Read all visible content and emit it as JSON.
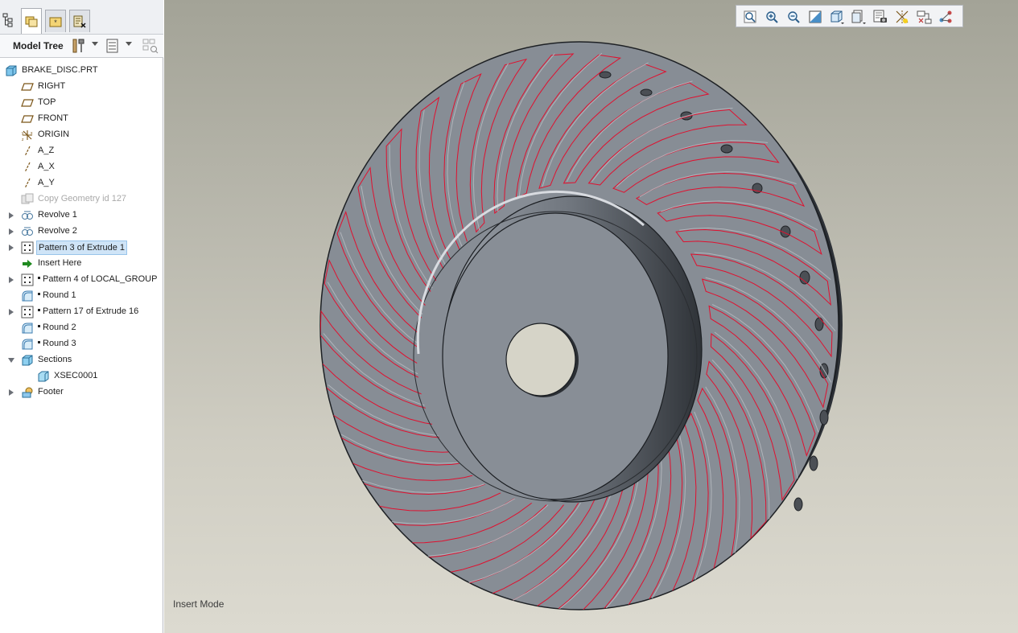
{
  "panel": {
    "title": "Model Tree",
    "tabs": [
      "model-tree-tab",
      "folder-browser-tab",
      "favorites-tab",
      "layer-tab"
    ]
  },
  "tree": {
    "items": [
      {
        "label": "BRAKE_DISC.PRT",
        "icon": "part-icon"
      },
      {
        "label": "RIGHT",
        "icon": "datum-plane-icon"
      },
      {
        "label": "TOP",
        "icon": "datum-plane-icon"
      },
      {
        "label": "FRONT",
        "icon": "datum-plane-icon"
      },
      {
        "label": "ORIGIN",
        "icon": "coordinate-system-icon"
      },
      {
        "label": "A_Z",
        "icon": "datum-axis-icon"
      },
      {
        "label": "A_X",
        "icon": "datum-axis-icon"
      },
      {
        "label": "A_Y",
        "icon": "datum-axis-icon"
      },
      {
        "label": "Copy Geometry id 127",
        "icon": "copy-geometry-icon",
        "suppressed": true
      },
      {
        "label": "Revolve 1",
        "icon": "revolve-icon",
        "expandable": true
      },
      {
        "label": "Revolve 2",
        "icon": "revolve-icon",
        "expandable": true
      },
      {
        "label": "Pattern 3 of Extrude 1",
        "icon": "pattern-icon",
        "expandable": true,
        "selected": true
      },
      {
        "label": "Insert Here",
        "icon": "insert-arrow-icon"
      },
      {
        "label": "Pattern 4 of LOCAL_GROUP",
        "icon": "pattern-icon",
        "expandable": true,
        "after_insert": true
      },
      {
        "label": "Round 1",
        "icon": "round-icon",
        "after_insert": true
      },
      {
        "label": "Pattern 17 of Extrude 16",
        "icon": "pattern-icon",
        "expandable": true,
        "after_insert": true
      },
      {
        "label": "Round 2",
        "icon": "round-icon",
        "after_insert": true
      },
      {
        "label": "Round 3",
        "icon": "round-icon",
        "after_insert": true
      },
      {
        "label": "Sections",
        "icon": "sections-icon",
        "expanded": true
      },
      {
        "label": "XSEC0001",
        "icon": "xsection-icon",
        "child": true
      },
      {
        "label": "Footer",
        "icon": "footer-icon",
        "expandable": true
      }
    ]
  },
  "view_toolbar": {
    "buttons": [
      "refit-icon",
      "zoom-in-icon",
      "zoom-out-icon",
      "repaint-icon",
      "display-style-icon",
      "saved-views-icon",
      "view-manager-icon",
      "datum-display-icon",
      "spin-center-icon",
      "annotation-display-icon"
    ]
  },
  "status": {
    "mode": "Insert Mode"
  },
  "colors": {
    "accent": "#cfe4f7",
    "edge_highlight": "#e0102f",
    "part_gray": "#868c94"
  }
}
